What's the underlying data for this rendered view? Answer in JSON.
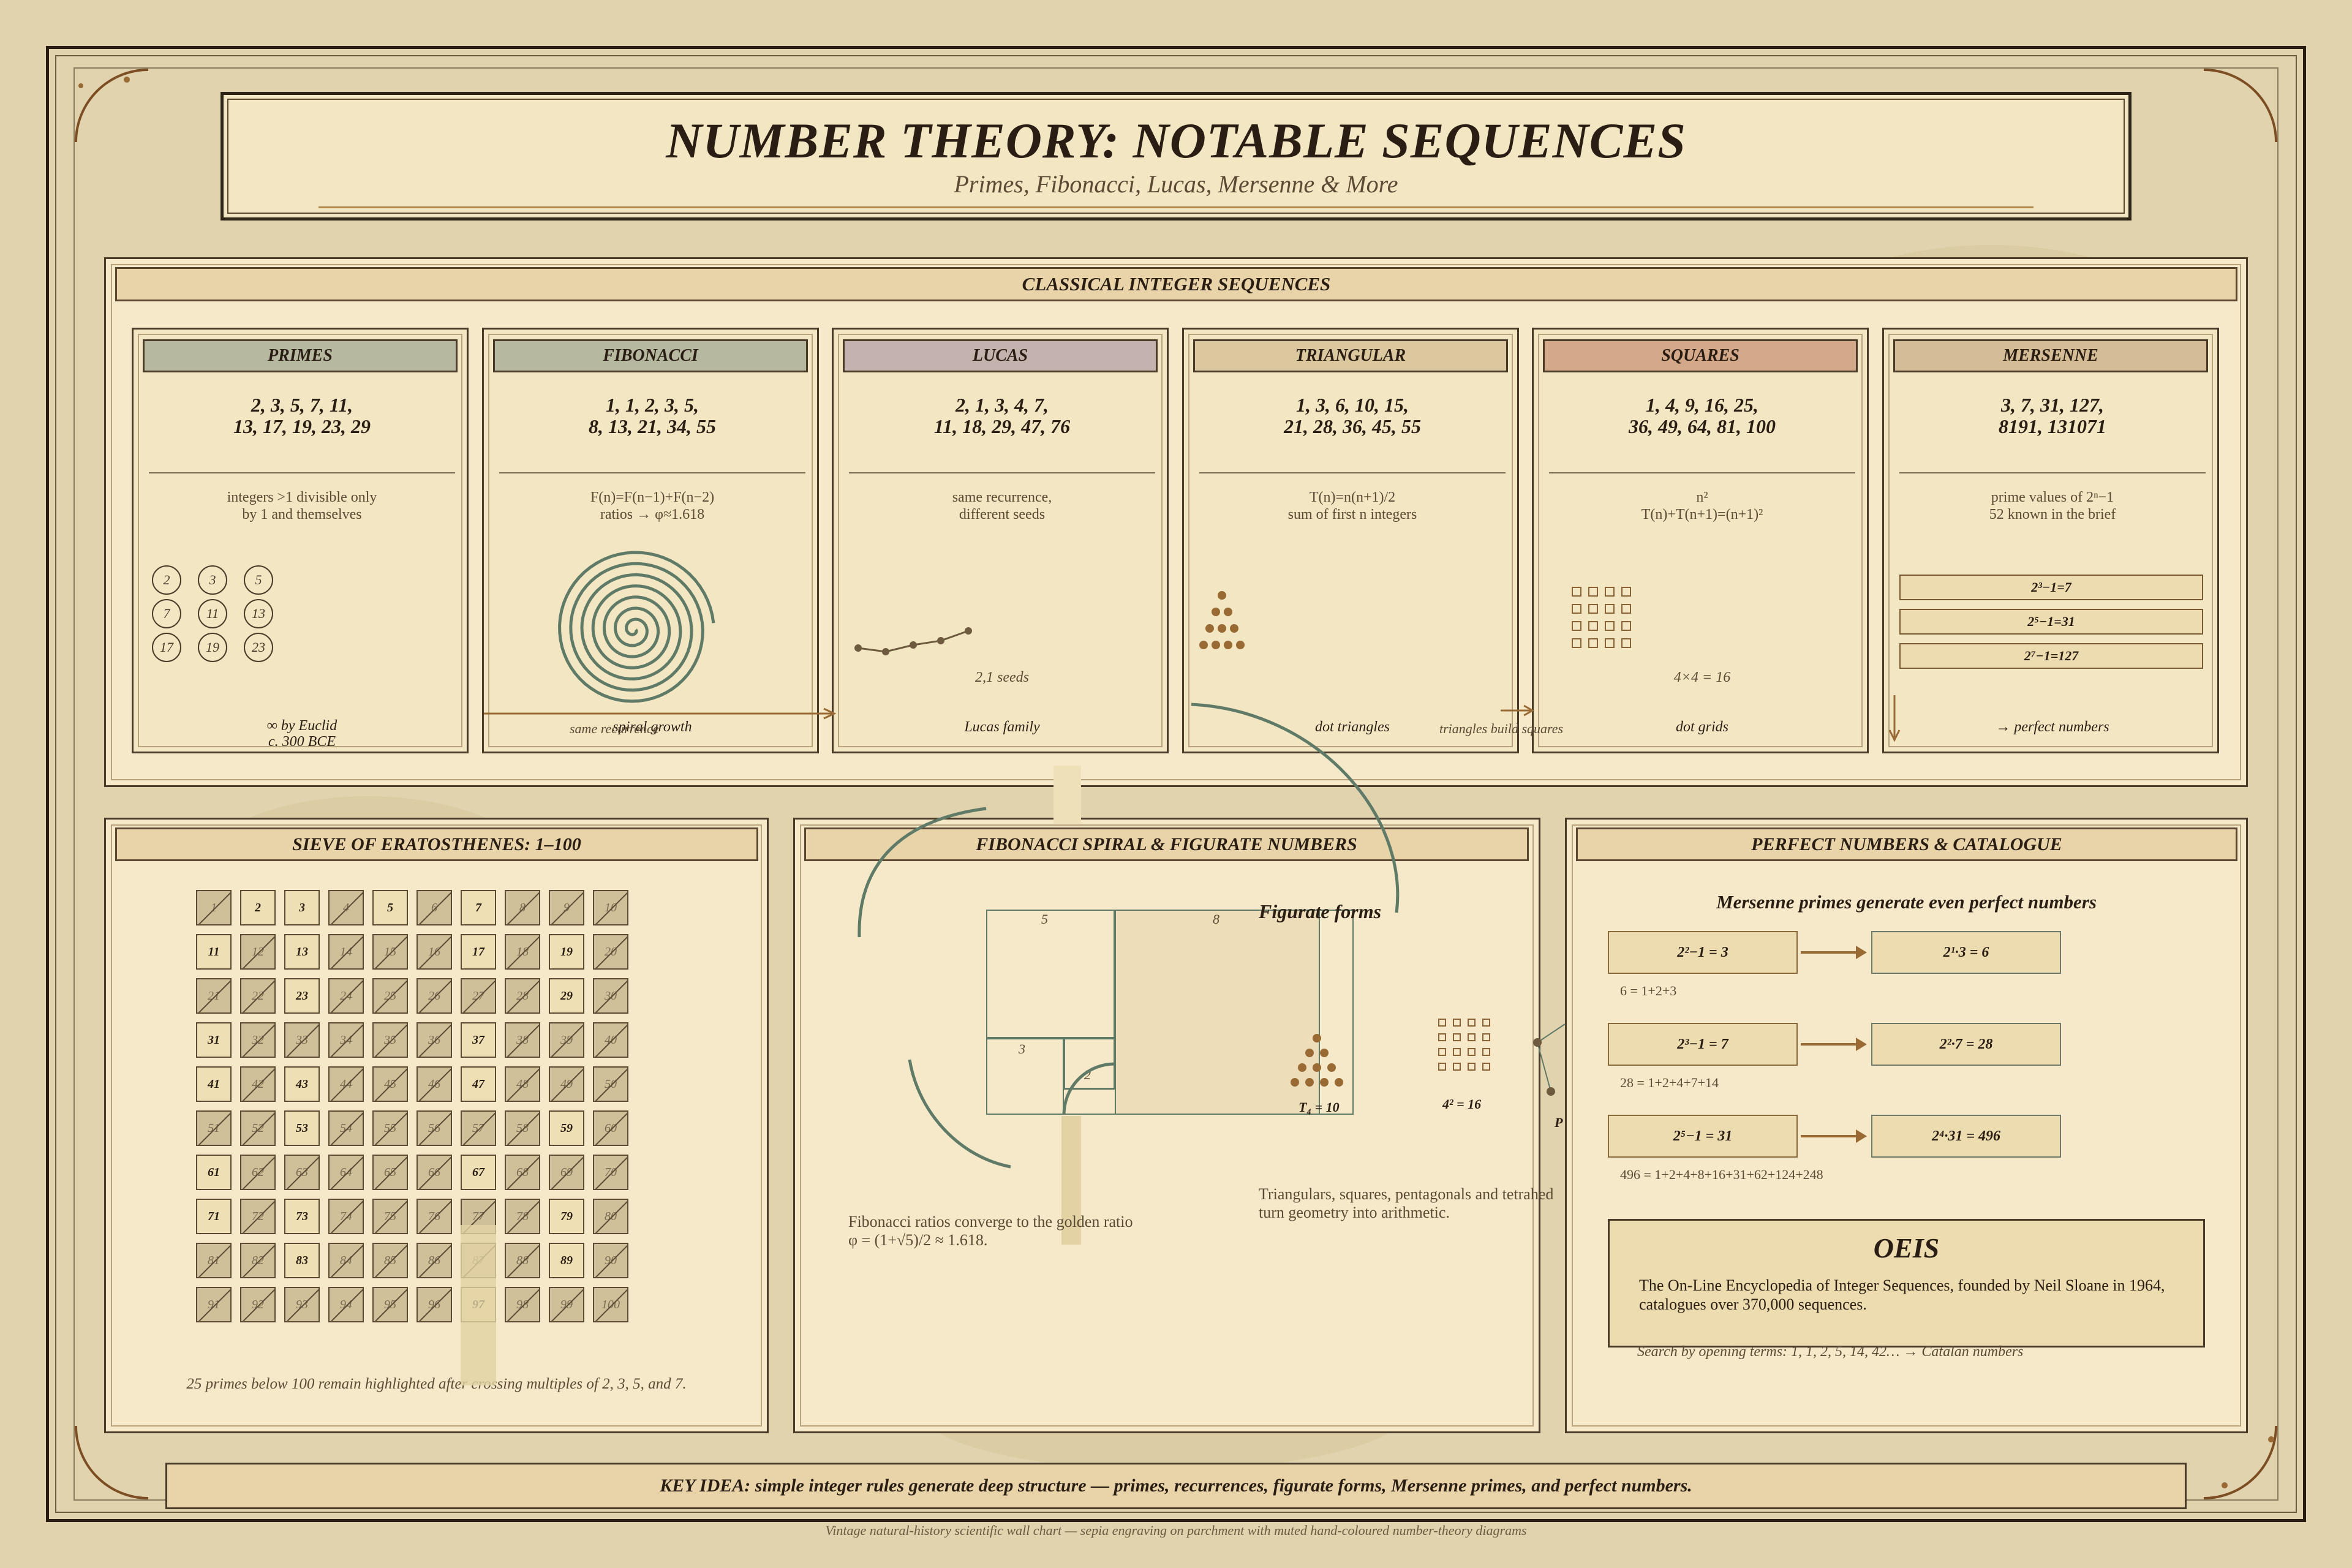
{
  "header": {
    "title": "NUMBER THEORY: NOTABLE SEQUENCES",
    "subtitle": "Primes, Fibonacci, Lucas, Mersenne & More"
  },
  "classical": {
    "heading": "CLASSICAL INTEGER SEQUENCES",
    "cards": [
      {
        "name": "PRIMES",
        "seq1": "2, 3, 5, 7, 11,",
        "seq2": "13, 17, 19, 23, 29",
        "desc1": "integers >1 divisible only",
        "desc2": "by 1 and themselves",
        "foot1": "∞ by Euclid",
        "foot2": "c. 300 BCE",
        "circles": [
          "2",
          "3",
          "5",
          "7",
          "11",
          "13",
          "17",
          "19",
          "23"
        ],
        "head_color": "#b6b9a0"
      },
      {
        "name": "FIBONACCI",
        "seq1": "1, 1, 2, 3, 5,",
        "seq2": "8, 13, 21, 34, 55",
        "desc1": "F(n)=F(n−1)+F(n−2)",
        "desc2": "ratios → φ≈1.618",
        "foot1": "spiral growth",
        "head_color": "#b6b9a0"
      },
      {
        "name": "LUCAS",
        "seq1": "2, 1, 3, 4, 7,",
        "seq2": "11, 18, 29, 47, 76",
        "desc1": "same recurrence,",
        "desc2": "different seeds",
        "note": "2,1 seeds",
        "foot1": "Lucas family",
        "head_color": "#c4b2ae"
      },
      {
        "name": "TRIANGULAR",
        "seq1": "1, 3, 6, 10, 15,",
        "seq2": "21, 28, 36, 45, 55",
        "desc1": "T(n)=n(n+1)/2",
        "desc2": "sum of first n integers",
        "foot1": "dot triangles",
        "head_color": "#dcc89e"
      },
      {
        "name": "SQUARES",
        "seq1": "1, 4, 9, 16, 25,",
        "seq2": "36, 49, 64, 81, 100",
        "desc1": "n²",
        "desc2": "T(n)+T(n+1)=(n+1)²",
        "note": "4×4 = 16",
        "foot1": "dot grids",
        "head_color": "#d4a98a"
      },
      {
        "name": "MERSENNE",
        "seq1": "3, 7, 31, 127,",
        "seq2": "8191, 131071",
        "desc1": "prime values of 2ⁿ−1",
        "desc2": "52 known in the brief",
        "boxes": [
          "2³−1=7",
          "2⁵−1=31",
          "2⁷−1=127"
        ],
        "foot1": "→ perfect numbers",
        "head_color": "#d4bd96"
      }
    ],
    "connector_1": "same recurrence",
    "connector_2": "triangles build squares"
  },
  "sieve": {
    "heading": "SIEVE OF ERATOSTHENES: 1–100",
    "primes": [
      2,
      3,
      5,
      7,
      11,
      13,
      17,
      19,
      23,
      29,
      31,
      37,
      41,
      43,
      47,
      53,
      59,
      61,
      67,
      71,
      73,
      79,
      83,
      89,
      97
    ],
    "caption": "25 primes below 100 remain highlighted after crossing multiples of 2, 3, 5, and 7."
  },
  "spiral": {
    "heading": "FIBONACCI SPIRAL & FIGURATE NUMBERS",
    "squares": [
      "5",
      "8",
      "3",
      "2"
    ],
    "figurate_title": "Figurate forms",
    "tri_label": "T₄ = 10",
    "sq_label": "4² = 16",
    "p_label": "P",
    "caption1": "Fibonacci ratios converge to the golden ratio",
    "caption2": "φ = (1+√5)/2 ≈ 1.618.",
    "figurate_caption1": "Triangulars, squares, pentagonals and tetrahed",
    "figurate_caption2": "turn geometry into arithmetic."
  },
  "perfect": {
    "heading": "PERFECT NUMBERS & CATALOGUE",
    "subtitle": "Mersenne primes generate even perfect numbers",
    "rows": [
      {
        "left": "2²−1 = 3",
        "right": "2¹·3 = 6",
        "sum": "6 = 1+2+3"
      },
      {
        "left": "2³−1 = 7",
        "right": "2²·7 = 28",
        "sum": "28 = 1+2+4+7+14"
      },
      {
        "left": "2⁵−1 = 31",
        "right": "2⁴·31 = 496",
        "sum": "496 = 1+2+4+8+16+31+62+124+248"
      }
    ],
    "oeis_title": "OEIS",
    "oeis_text": "The On-Line Encyclopedia of Integer Sequences, founded by Neil Sloane in 1964, catalogues over 370,000 sequences.",
    "search_note": "Search by opening terms: 1, 1, 2, 5, 14, 42… → Catalan numbers"
  },
  "footer": {
    "key_idea": "KEY IDEA: simple integer rules generate deep structure — primes, recurrences, figurate forms, Mersenne primes, and perfect numbers.",
    "caption": "Vintage natural-history scientific wall chart — sepia engraving on parchment with muted hand-coloured number-theory diagrams"
  },
  "colors": {
    "parchment": "#e1d3ad",
    "ink": "#2a1e14",
    "sepia": "#7d4e24",
    "green": "#5f7a66"
  }
}
